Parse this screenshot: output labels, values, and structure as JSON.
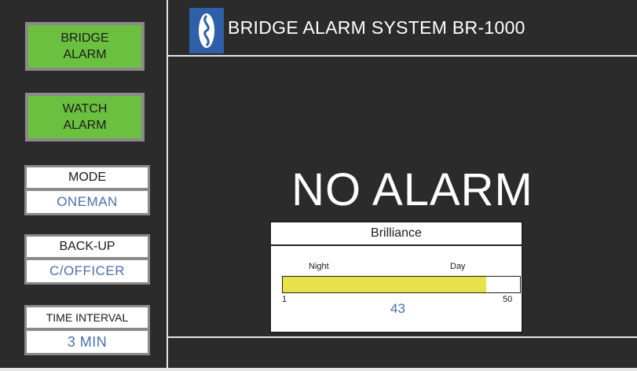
{
  "sidebar": {
    "bridge_alarm": "BRIDGE\nALARM",
    "watch_alarm": "WATCH\nALARM",
    "mode": {
      "label": "MODE",
      "value": "ONEMAN"
    },
    "backup": {
      "label": "BACK-UP",
      "value": "C/OFFICER"
    },
    "interval": {
      "label": "TIME INTERVAL",
      "value": "3 MIN"
    }
  },
  "header": {
    "title": "BRIDGE ALARM SYSTEM BR-1000",
    "logo_icon": "propeller-logo-icon"
  },
  "status": {
    "text": "NO ALARM"
  },
  "brilliance": {
    "title": "Brilliance",
    "night_label": "Night",
    "day_label": "Day",
    "min": "1",
    "max": "50",
    "value": "43",
    "level": 43
  },
  "colors": {
    "alarm_green": "#6cc040",
    "value_blue": "#4a6fb0",
    "brilliance_fill": "#e8e24a",
    "logo_blue": "#2f5fa8"
  }
}
